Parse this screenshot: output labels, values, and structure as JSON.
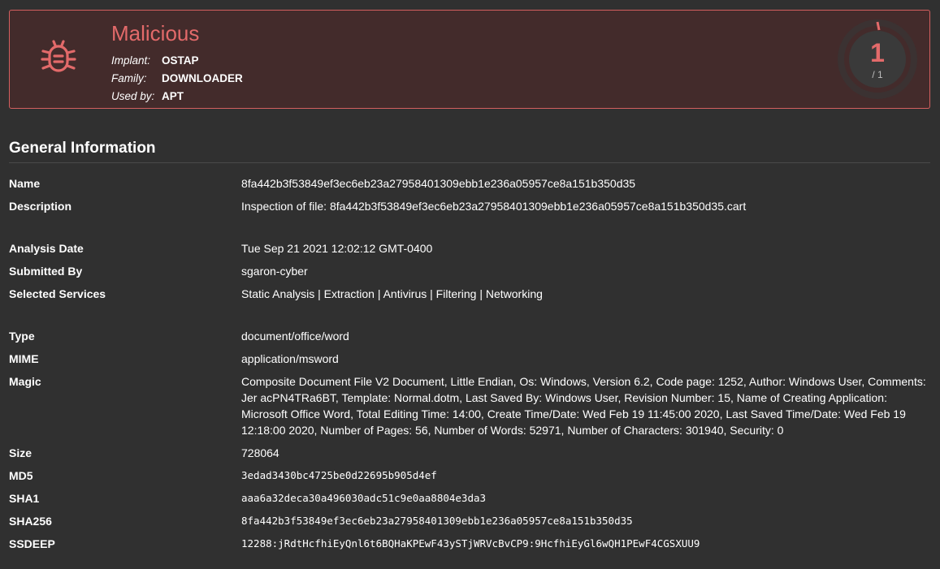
{
  "verdict": {
    "title": "Malicious",
    "implant_label": "Implant:",
    "implant_value": "OSTAP",
    "family_label": "Family:",
    "family_value": "DOWNLOADER",
    "used_by_label": "Used by:",
    "used_by_value": "APT",
    "icon": "bug-icon",
    "accent_color": "#e36a6a"
  },
  "score": {
    "value": "1",
    "denominator": "/ 1",
    "fraction": 1.0
  },
  "section": {
    "title": "General Information"
  },
  "fields": {
    "name": {
      "label": "Name",
      "value": "8fa442b3f53849ef3ec6eb23a27958401309ebb1e236a05957ce8a151b350d35"
    },
    "description": {
      "label": "Description",
      "value": "Inspection of file: 8fa442b3f53849ef3ec6eb23a27958401309ebb1e236a05957ce8a151b350d35.cart"
    },
    "analysis_date": {
      "label": "Analysis Date",
      "value": "Tue Sep 21 2021 12:02:12 GMT-0400"
    },
    "submitted_by": {
      "label": "Submitted By",
      "value": "sgaron-cyber"
    },
    "selected_services": {
      "label": "Selected Services",
      "value": "Static Analysis | Extraction | Antivirus | Filtering | Networking"
    },
    "type": {
      "label": "Type",
      "value": "document/office/word"
    },
    "mime": {
      "label": "MIME",
      "value": "application/msword"
    },
    "magic": {
      "label": "Magic",
      "value": "Composite Document File V2 Document, Little Endian, Os: Windows, Version 6.2, Code page: 1252, Author: Windows User, Comments: Jer acPN4TRa6BT, Template: Normal.dotm, Last Saved By: Windows User, Revision Number: 15, Name of Creating Application: Microsoft Office Word, Total Editing Time: 14:00, Create Time/Date: Wed Feb 19 11:45:00 2020, Last Saved Time/Date: Wed Feb 19 12:18:00 2020, Number of Pages: 56, Number of Words: 52971, Number of Characters: 301940, Security: 0"
    },
    "size": {
      "label": "Size",
      "value": "728064"
    },
    "md5": {
      "label": "MD5",
      "value": "3edad3430bc4725be0d22695b905d4ef"
    },
    "sha1": {
      "label": "SHA1",
      "value": "aaa6a32deca30a496030adc51c9e0aa8804e3da3"
    },
    "sha256": {
      "label": "SHA256",
      "value": "8fa442b3f53849ef3ec6eb23a27958401309ebb1e236a05957ce8a151b350d35"
    },
    "ssdeep": {
      "label": "SSDEEP",
      "value": "12288:jRdtHcfhiEyQnl6t6BQHaKPEwF43ySTjWRVcBvCP9:9HcfhiEyGl6wQH1PEwF4CGSXUU9"
    }
  }
}
